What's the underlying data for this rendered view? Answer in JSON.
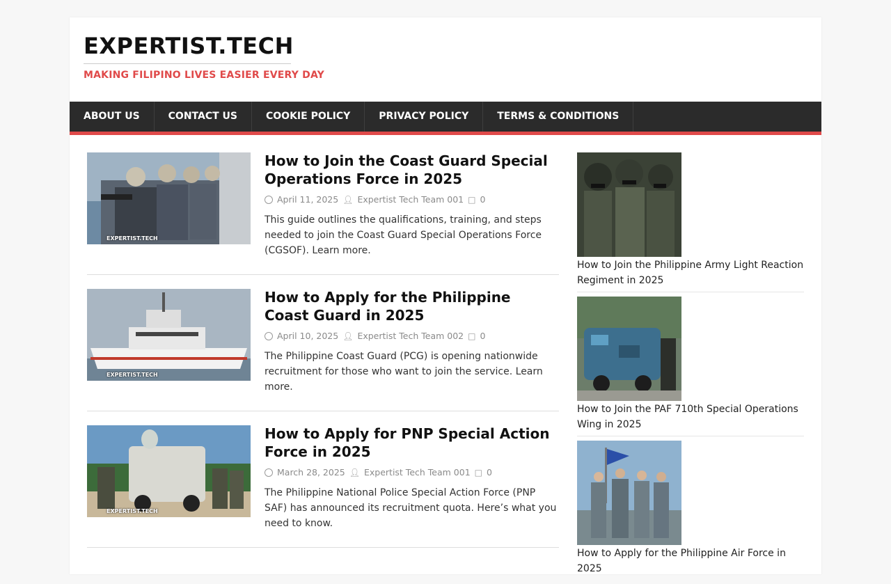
{
  "site": {
    "title": "EXPERTIST.TECH",
    "tagline": "MAKING FILIPINO LIVES EASIER EVERY DAY",
    "accent_color": "#e04a4a",
    "nav_bg": "#2b2b2b"
  },
  "nav": [
    {
      "label": "ABOUT US"
    },
    {
      "label": "CONTACT US"
    },
    {
      "label": "COOKIE POLICY"
    },
    {
      "label": "PRIVACY POLICY"
    },
    {
      "label": "TERMS & CONDITIONS"
    }
  ],
  "posts": [
    {
      "title": "How to Join the Coast Guard Special Operations Force in 2025",
      "date": "April 11, 2025",
      "author": "Expertist Tech Team 001",
      "comments": "0",
      "excerpt": "This guide outlines the qualifications, training, and steps needed to join the Coast Guard Special Operations Force (CGSOF). Learn more."
    },
    {
      "title": "How to Apply for the Philippine Coast Guard in 2025",
      "date": "April 10, 2025",
      "author": "Expertist Tech Team 002",
      "comments": "0",
      "excerpt": "The Philippine Coast Guard (PCG) is opening nationwide recruitment for those who want to join the service. Learn more."
    },
    {
      "title": "How to Apply for PNP Special Action Force in 2025",
      "date": "March 28, 2025",
      "author": "Expertist Tech Team 001",
      "comments": "0",
      "excerpt": "The Philippine National Police Special Action Force (PNP SAF) has announced its recruitment quota. Here’s what you need to know."
    }
  ],
  "sidebar": [
    {
      "title": "How to Join the Philippine Army Light Reaction Regiment in 2025"
    },
    {
      "title": "How to Join the PAF 710th Special Operations Wing in 2025"
    },
    {
      "title": "How to Apply for the Philippine Air Force in 2025"
    }
  ],
  "watermark": "EXPERTIST.TECH"
}
